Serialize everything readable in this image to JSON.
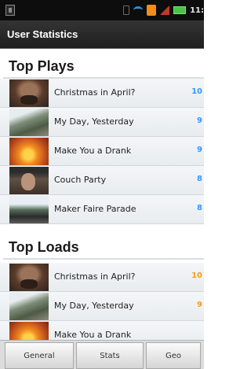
{
  "status_bar": {
    "time": "11:",
    "icons": [
      "phone-icon",
      "wifi-icon",
      "alert-icon",
      "signal-icon",
      "battery-icon"
    ],
    "wifi_color": "#2f8fd8",
    "battery_color": "#47c447",
    "alert_color": "#f28c1a"
  },
  "title": "User Statistics",
  "top_plays": {
    "heading": "Top Plays",
    "value_color": "#3399ff",
    "items": [
      {
        "label": "Christmas in April?",
        "value": "10",
        "thumb": "face"
      },
      {
        "label": "My Day, Yesterday",
        "value": "9",
        "thumb": "outdoor"
      },
      {
        "label": "Make You a Drank",
        "value": "9",
        "thumb": "orange"
      },
      {
        "label": "Couch Party",
        "value": "8",
        "thumb": "couch"
      },
      {
        "label": "Maker Faire Parade",
        "value": "8",
        "thumb": "parade"
      }
    ]
  },
  "top_loads": {
    "heading": "Top Loads",
    "value_color": "#f0a020",
    "items": [
      {
        "label": "Christmas in April?",
        "value": "10",
        "thumb": "face"
      },
      {
        "label": "My Day, Yesterday",
        "value": "9",
        "thumb": "outdoor"
      },
      {
        "label": "Make You a Drank",
        "value": "",
        "thumb": "orange"
      }
    ]
  },
  "tabs": [
    {
      "label": "General"
    },
    {
      "label": "Stats"
    },
    {
      "label": "Geo"
    }
  ]
}
